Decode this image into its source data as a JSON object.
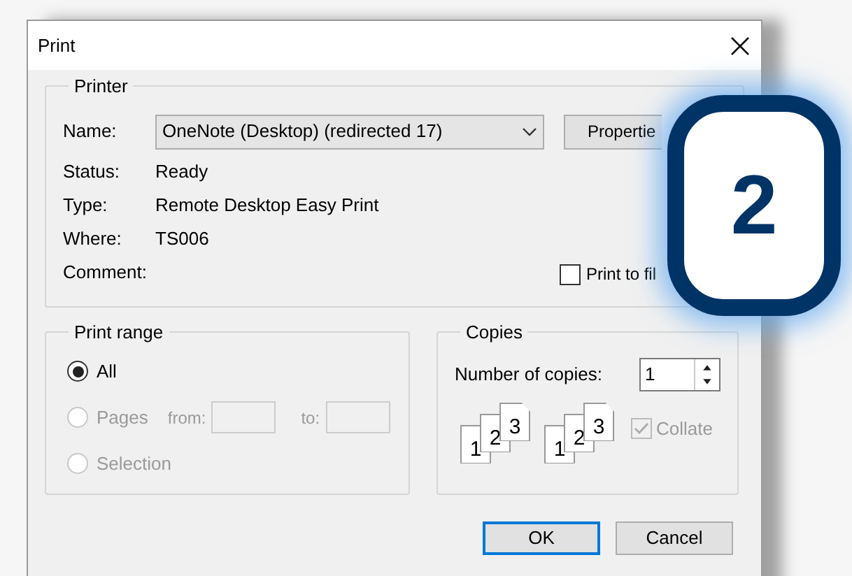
{
  "window": {
    "title": "Print"
  },
  "printer": {
    "group_label": "Printer",
    "name_label": "Name:",
    "name_value": "OneNote (Desktop) (redirected 17)",
    "properties_button": "Propertie",
    "info": [
      {
        "label": "Status:",
        "value": "Ready"
      },
      {
        "label": "Type:",
        "value": "Remote Desktop Easy Print"
      },
      {
        "label": "Where:",
        "value": "TS006"
      },
      {
        "label": "Comment:"
      }
    ],
    "print_to_file": {
      "label": "Print to fil",
      "checked": false
    }
  },
  "print_range": {
    "group_label": "Print range",
    "options": [
      {
        "label": "All",
        "selected": true,
        "disabled": false
      },
      {
        "label": "Pages",
        "selected": false,
        "disabled": true
      },
      {
        "label": "Selection",
        "selected": false,
        "disabled": true
      }
    ],
    "from_label": "from:",
    "to_label": "to:"
  },
  "copies": {
    "group_label": "Copies",
    "count_label": "Number of copies:",
    "count_value": "1",
    "collate_sets": [
      [
        "1",
        "2",
        "3"
      ],
      [
        "1",
        "2",
        "3"
      ]
    ],
    "collate": {
      "label": "Collate",
      "checked": true,
      "disabled": true
    }
  },
  "buttons": [
    {
      "label": "OK",
      "default": true
    },
    {
      "label": "Cancel",
      "default": false
    }
  ],
  "callout": {
    "number": "2"
  }
}
